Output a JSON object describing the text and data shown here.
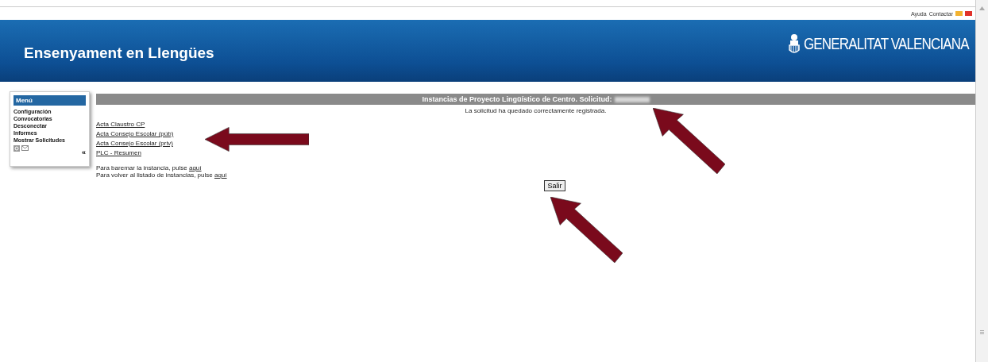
{
  "top_links": [
    "Ayuda",
    "Contactar"
  ],
  "flags": [
    {
      "color": "#f2b230"
    },
    {
      "color": "#e0322a"
    }
  ],
  "header": {
    "title": "Ensenyament en Llengües",
    "logo_text": "GENERALITAT VALENCIANA"
  },
  "menu": {
    "title": "Menú",
    "items": [
      "Configuración",
      "Convocatorias",
      "Desconectar",
      "Informes",
      "Mostrar Solicitudes"
    ],
    "collapse": "«"
  },
  "banner": {
    "title": "Instancias de Proyecto Lingüístico de Centro. Solicitud:",
    "redacted": true
  },
  "message": "La solicitud ha quedado correctamente registrada.",
  "documents": [
    "Acta Claustro CP",
    "Acta Consejo Escolar (púb)",
    "Acta Consejo Escolar (priv)",
    "PLC - Resumen"
  ],
  "instructions": [
    {
      "text": "Para baremar la instancia, pulse",
      "link": "aquí"
    },
    {
      "text": "Para volver al listado de instancias, pulse",
      "link": "aquí"
    }
  ],
  "button": "Salir",
  "annotations": [
    {
      "kind": "arrow-left"
    },
    {
      "kind": "arrow-up-left"
    },
    {
      "kind": "arrow-up-left"
    }
  ]
}
